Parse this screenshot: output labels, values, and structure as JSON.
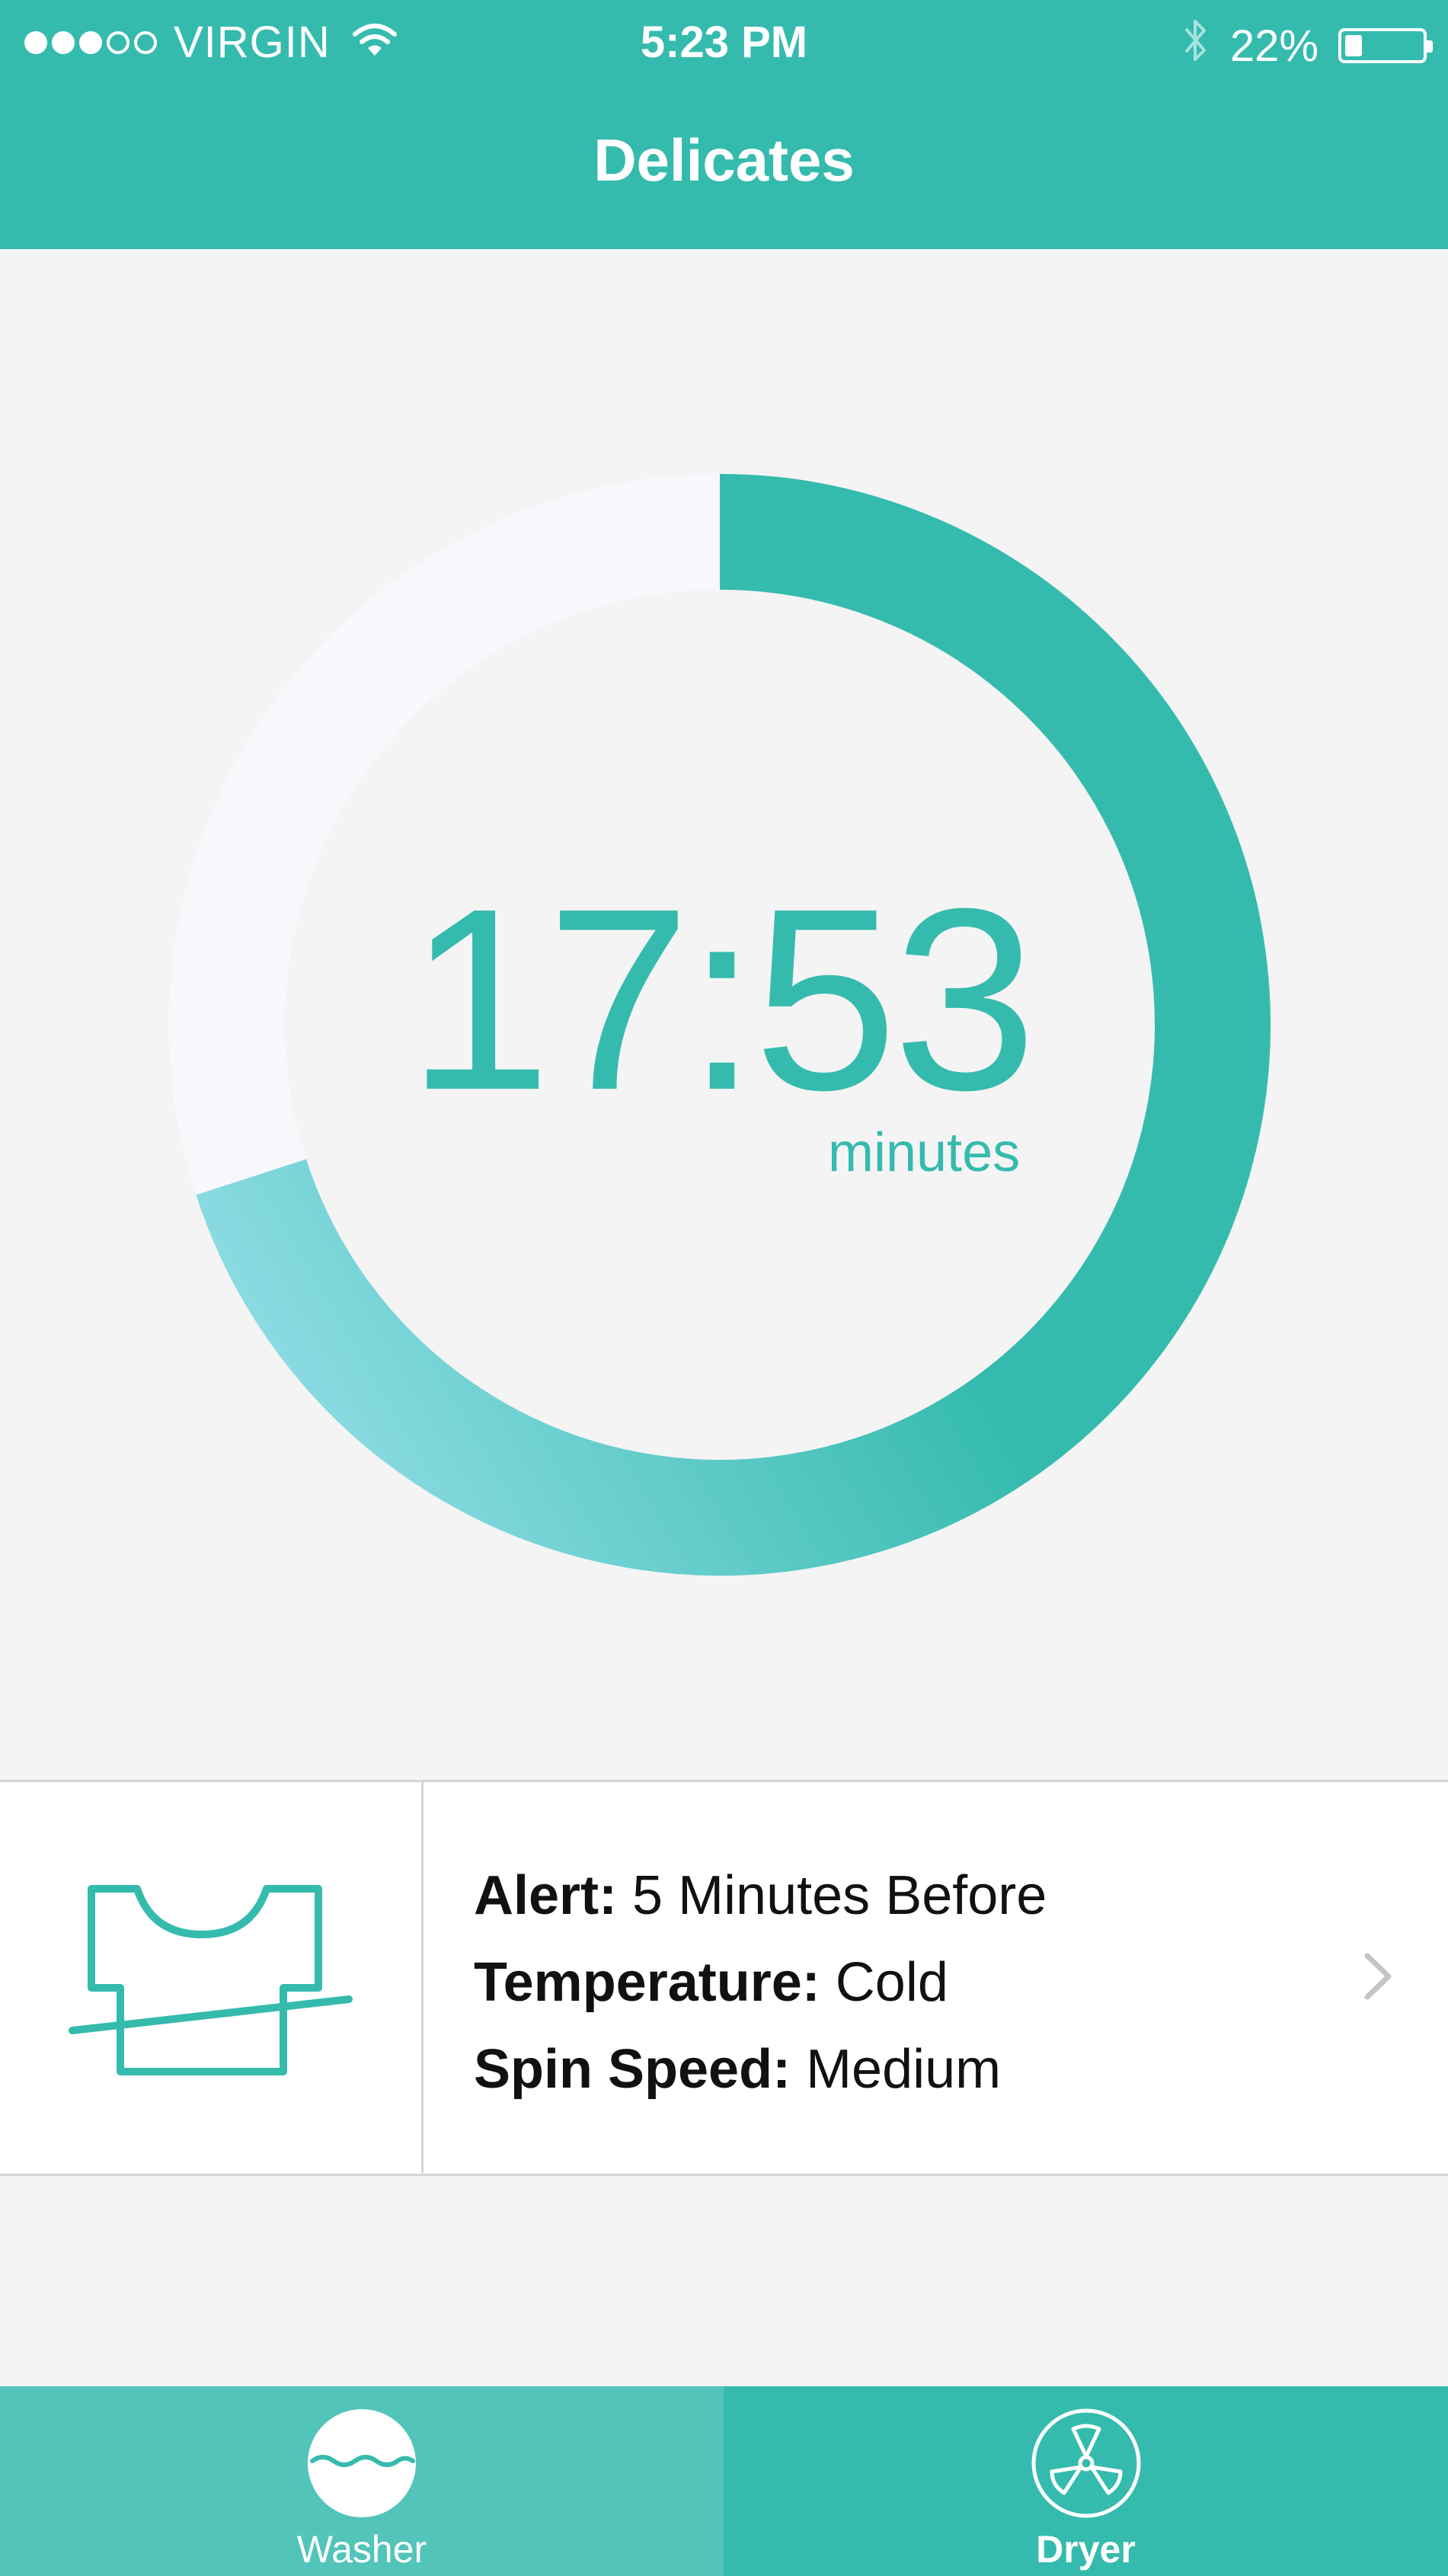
{
  "status_bar": {
    "carrier": "VIRGIN",
    "time": "5:23 PM",
    "battery_percent": "22%",
    "battery_level": 0.22,
    "signal_bars": 3,
    "signal_total": 5
  },
  "header": {
    "title": "Delicates"
  },
  "timer": {
    "value": "17:53",
    "unit": "minutes",
    "progress_fraction": 0.7,
    "colors": {
      "active": "#35bbae",
      "active_light": "#8edce4",
      "track": "#f8f8fc"
    }
  },
  "cycle_settings": {
    "icon": "shirt-crossed-icon",
    "items": [
      {
        "label": "Alert:",
        "value": "5 Minutes Before"
      },
      {
        "label": "Temperature:",
        "value": "Cold"
      },
      {
        "label": "Spin Speed:",
        "value": "Medium"
      }
    ]
  },
  "tabs": [
    {
      "label": "Washer",
      "icon": "washer-icon",
      "selected": true
    },
    {
      "label": "Dryer",
      "icon": "dryer-fan-icon",
      "selected": false
    }
  ],
  "colors": {
    "accent": "#35bbae",
    "accent_light": "#52c4b9",
    "background": "#f4f4f4"
  }
}
